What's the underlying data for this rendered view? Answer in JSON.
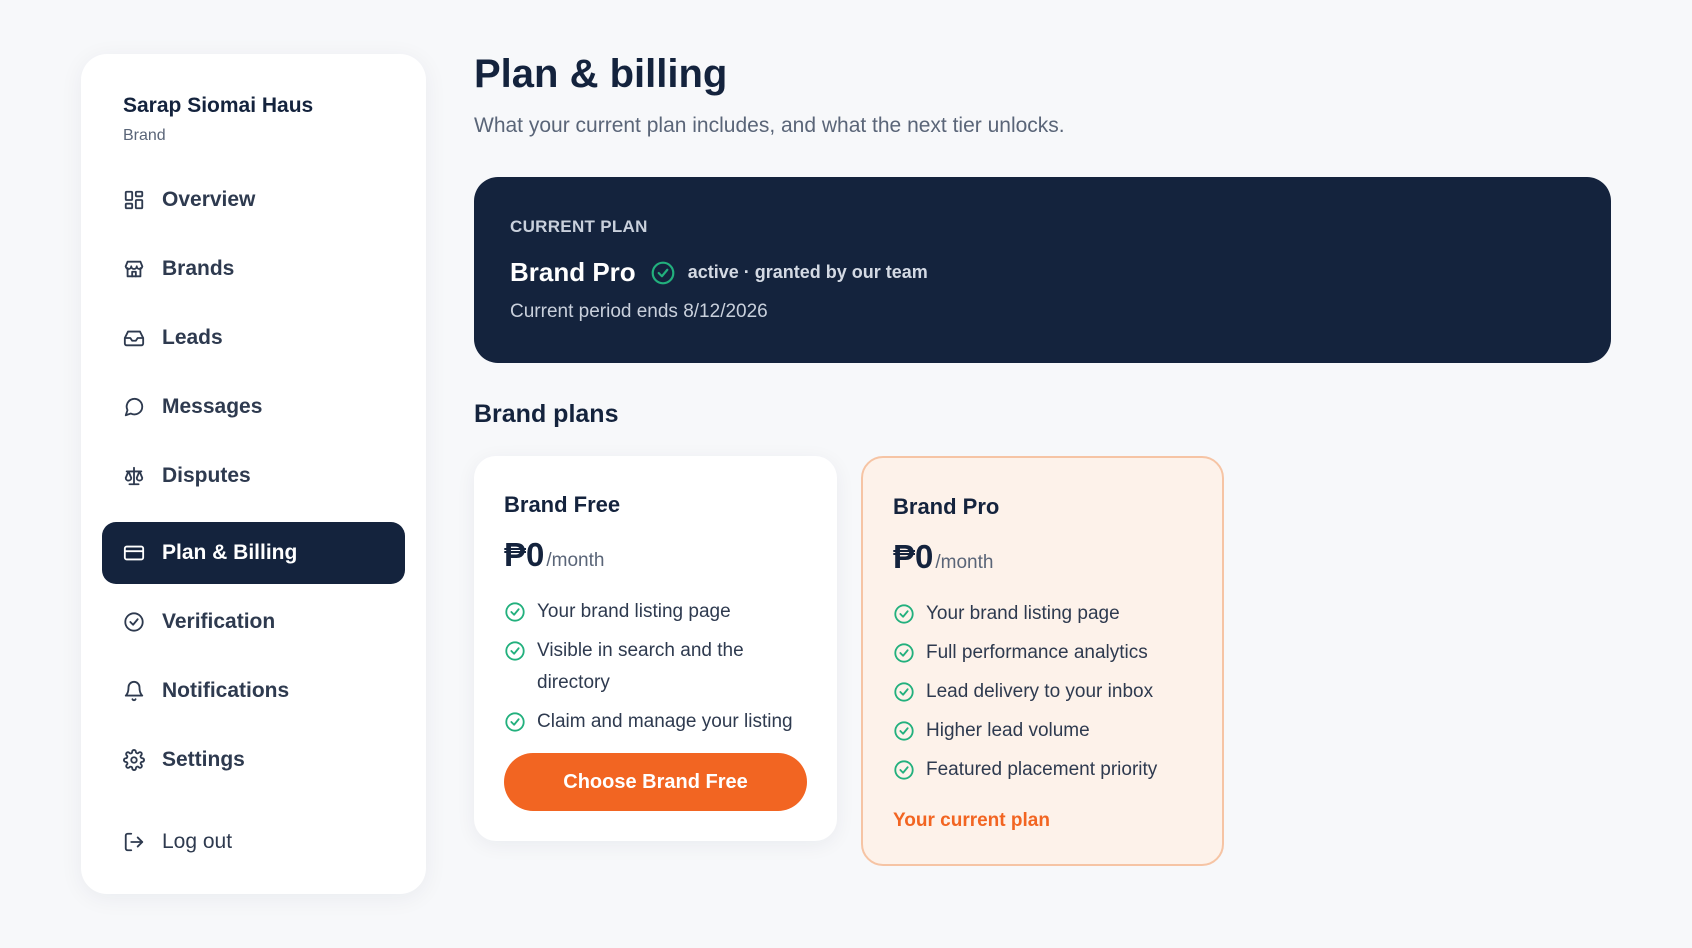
{
  "sidebar": {
    "account_name": "Sarap Siomai Haus",
    "account_role": "Brand",
    "items": [
      {
        "label": "Overview",
        "icon": "grid-icon"
      },
      {
        "label": "Brands",
        "icon": "store-icon"
      },
      {
        "label": "Leads",
        "icon": "inbox-icon"
      },
      {
        "label": "Messages",
        "icon": "chat-icon"
      },
      {
        "label": "Disputes",
        "icon": "scale-icon"
      },
      {
        "label": "Plan & Billing",
        "icon": "credit-card-icon",
        "active": true
      },
      {
        "label": "Verification",
        "icon": "badge-check-icon"
      },
      {
        "label": "Notifications",
        "icon": "bell-icon"
      },
      {
        "label": "Settings",
        "icon": "gear-icon"
      }
    ],
    "logout_label": "Log out"
  },
  "header": {
    "title": "Plan & billing",
    "subtitle": "What your current plan includes, and what the next tier unlocks."
  },
  "current_plan": {
    "eyebrow": "CURRENT PLAN",
    "name": "Brand Pro",
    "status": "active · granted by our team",
    "period": "Current period ends 8/12/2026"
  },
  "plans_section": {
    "title": "Brand plans",
    "plans": [
      {
        "name": "Brand Free",
        "price": "₱0",
        "unit": "/month",
        "features": [
          "Your brand listing page",
          "Visible in search and the directory",
          "Claim and manage your listing"
        ],
        "button_label": "Choose Brand Free"
      },
      {
        "name": "Brand Pro",
        "price": "₱0",
        "unit": "/month",
        "features": [
          "Your brand listing page",
          "Full performance analytics",
          "Lead delivery to your inbox",
          "Higher lead volume",
          "Featured placement priority"
        ],
        "current_label": "Your current plan"
      }
    ]
  },
  "colors": {
    "navy": "#14233d",
    "accent_orange": "#f26522",
    "check_green": "#22b07d",
    "pro_card_bg": "#fdf2ea"
  }
}
